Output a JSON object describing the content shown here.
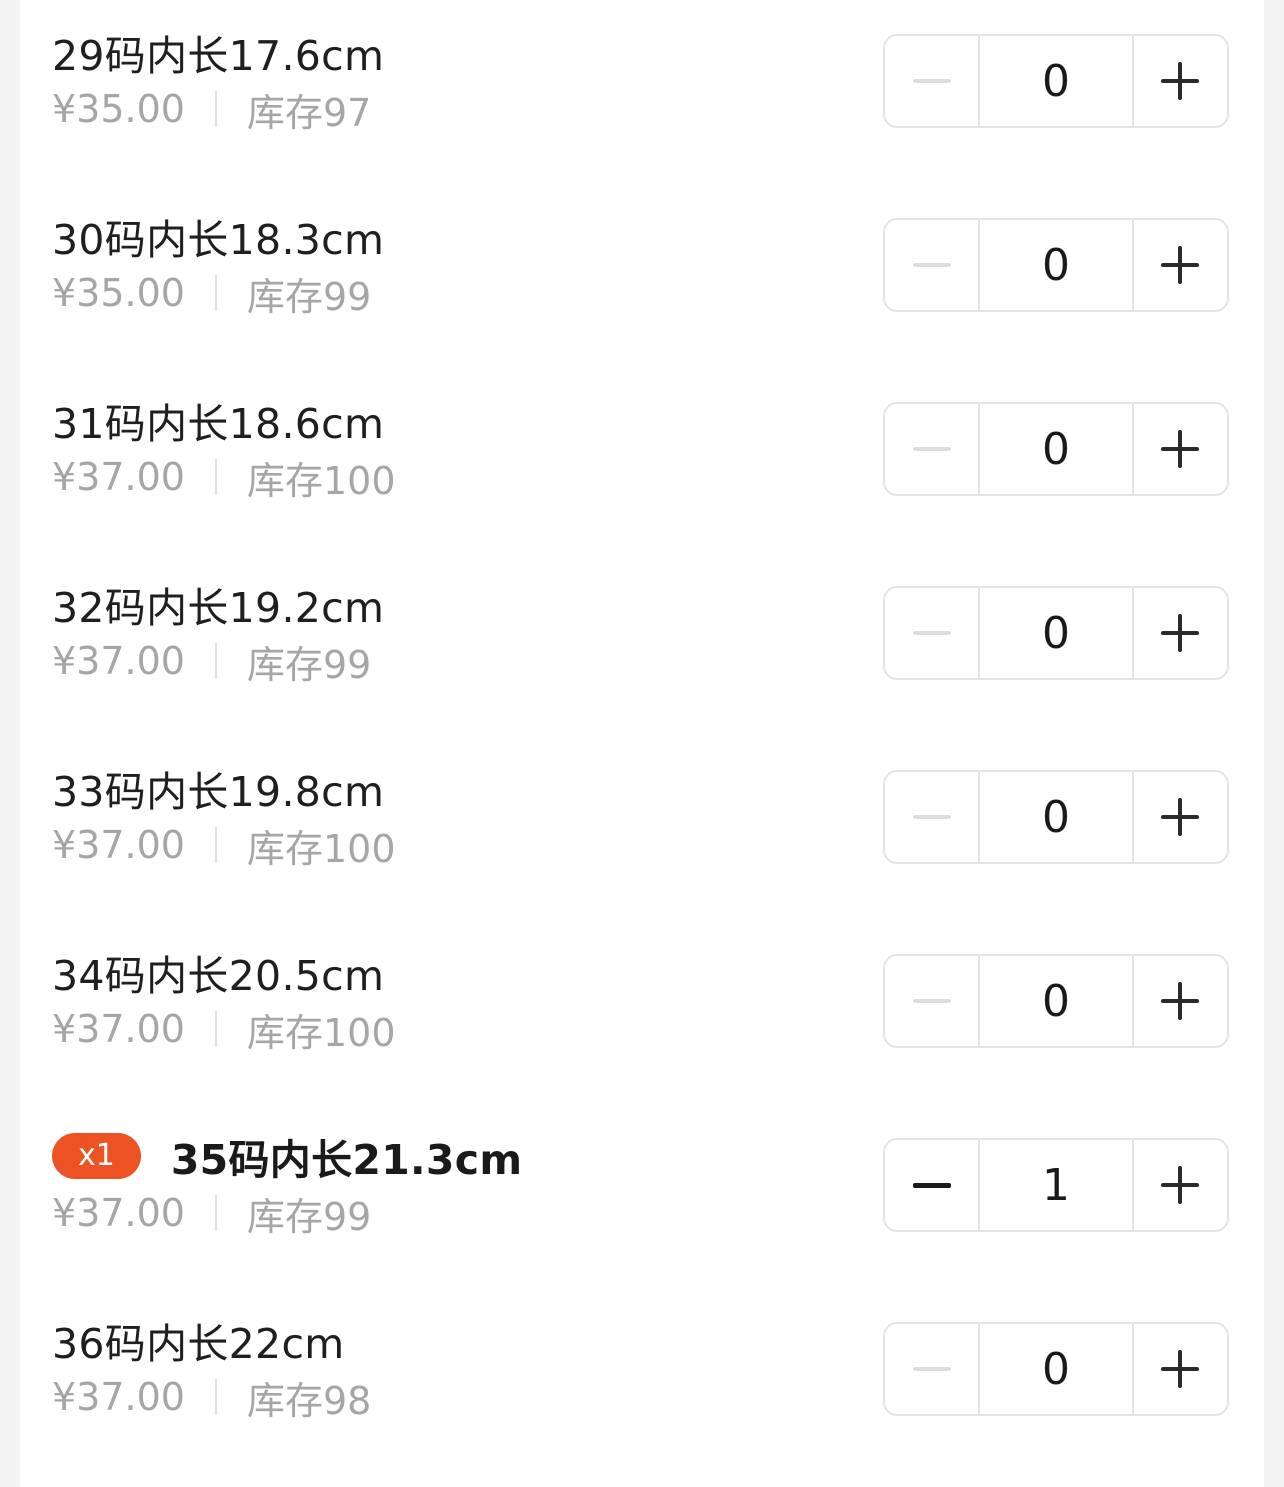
{
  "sku_list": {
    "items": [
      {
        "name": "29码内长17.6cm",
        "price": "¥35.00",
        "stock": "库存97",
        "quantity": "0",
        "badge": ""
      },
      {
        "name": "30码内长18.3cm",
        "price": "¥35.00",
        "stock": "库存99",
        "quantity": "0",
        "badge": ""
      },
      {
        "name": "31码内长18.6cm",
        "price": "¥37.00",
        "stock": "库存100",
        "quantity": "0",
        "badge": ""
      },
      {
        "name": "32码内长19.2cm",
        "price": "¥37.00",
        "stock": "库存99",
        "quantity": "0",
        "badge": ""
      },
      {
        "name": "33码内长19.8cm",
        "price": "¥37.00",
        "stock": "库存100",
        "quantity": "0",
        "badge": ""
      },
      {
        "name": "34码内长20.5cm",
        "price": "¥37.00",
        "stock": "库存100",
        "quantity": "0",
        "badge": ""
      },
      {
        "name": "35码内长21.3cm",
        "price": "¥37.00",
        "stock": "库存99",
        "quantity": "1",
        "badge": "x1"
      },
      {
        "name": "36码内长22cm",
        "price": "¥37.00",
        "stock": "库存98",
        "quantity": "0",
        "badge": ""
      }
    ]
  },
  "icons": {
    "decrement": "minus-icon",
    "increment": "plus-icon"
  },
  "colors": {
    "badge_background": "#ec5224",
    "muted_text": "#a6a6a6",
    "primary_text": "#1a1a1a",
    "border": "#e4e4e4"
  }
}
